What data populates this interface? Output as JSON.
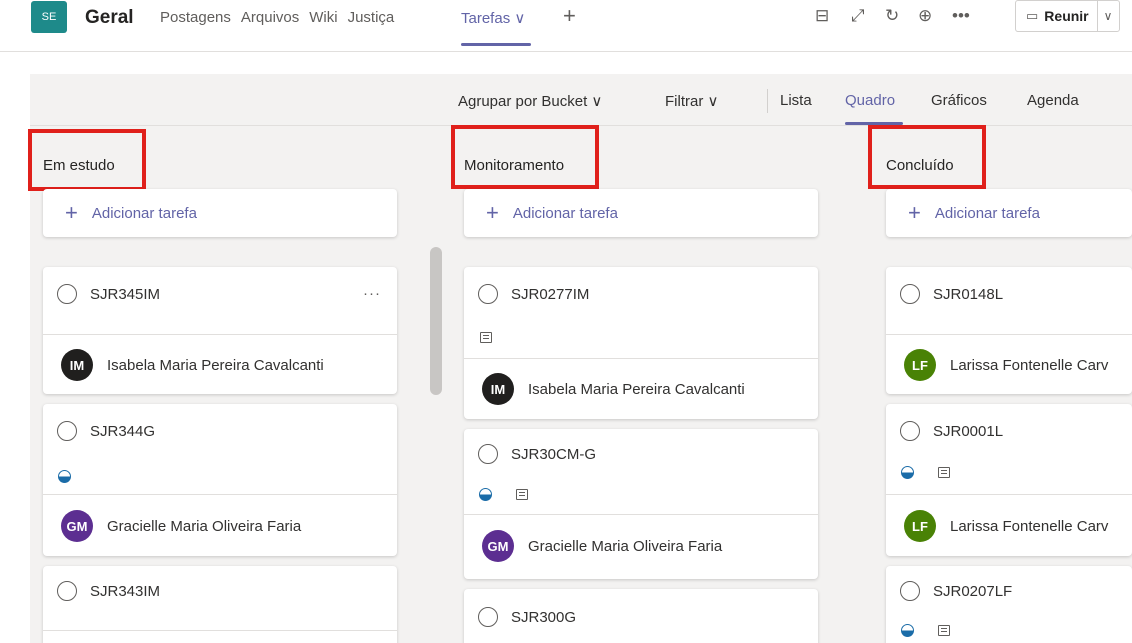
{
  "header": {
    "team_avatar": "SE",
    "channel": "Geral",
    "tabs": [
      "Postagens",
      "Arquivos",
      "Wiki",
      "Justiça"
    ],
    "active_tab": "Tarefas ∨",
    "reunir": "Reunir"
  },
  "toolbar": {
    "group_by": "Agrupar por Bucket ∨",
    "filter": "Filtrar ∨",
    "views": [
      "Lista",
      "Quadro",
      "Gráficos",
      "Agenda"
    ],
    "active_view": "Quadro"
  },
  "add_task_label": "Adicionar tarefa",
  "buckets": [
    {
      "name": "Em estudo",
      "tasks": [
        {
          "title": "SJR345IM",
          "assignee": "Isabela Maria Pereira Cavalcanti",
          "initials": "IM"
        },
        {
          "title": "SJR344G",
          "assignee": "Gracielle Maria Oliveira Faria",
          "initials": "GM"
        },
        {
          "title": "SJR343IM"
        }
      ]
    },
    {
      "name": "Monitoramento",
      "tasks": [
        {
          "title": "SJR0277IM",
          "assignee": "Isabela Maria Pereira Cavalcanti",
          "initials": "IM"
        },
        {
          "title": "SJR30CM-G",
          "assignee": "Gracielle Maria Oliveira Faria",
          "initials": "GM"
        },
        {
          "title": "SJR300G"
        }
      ]
    },
    {
      "name": "Concluído",
      "tasks": [
        {
          "title": "SJR0148L",
          "assignee": "Larissa Fontenelle Carv",
          "initials": "LF"
        },
        {
          "title": "SJR0001L",
          "assignee": "Larissa Fontenelle Carv",
          "initials": "LF"
        },
        {
          "title": "SJR0207LF"
        }
      ]
    }
  ],
  "colors": {
    "accent": "#6264a7",
    "highlight_box": "#e0201b",
    "avatar_im": "#201f1e",
    "avatar_gm": "#5c2e91",
    "avatar_lf": "#498205"
  }
}
